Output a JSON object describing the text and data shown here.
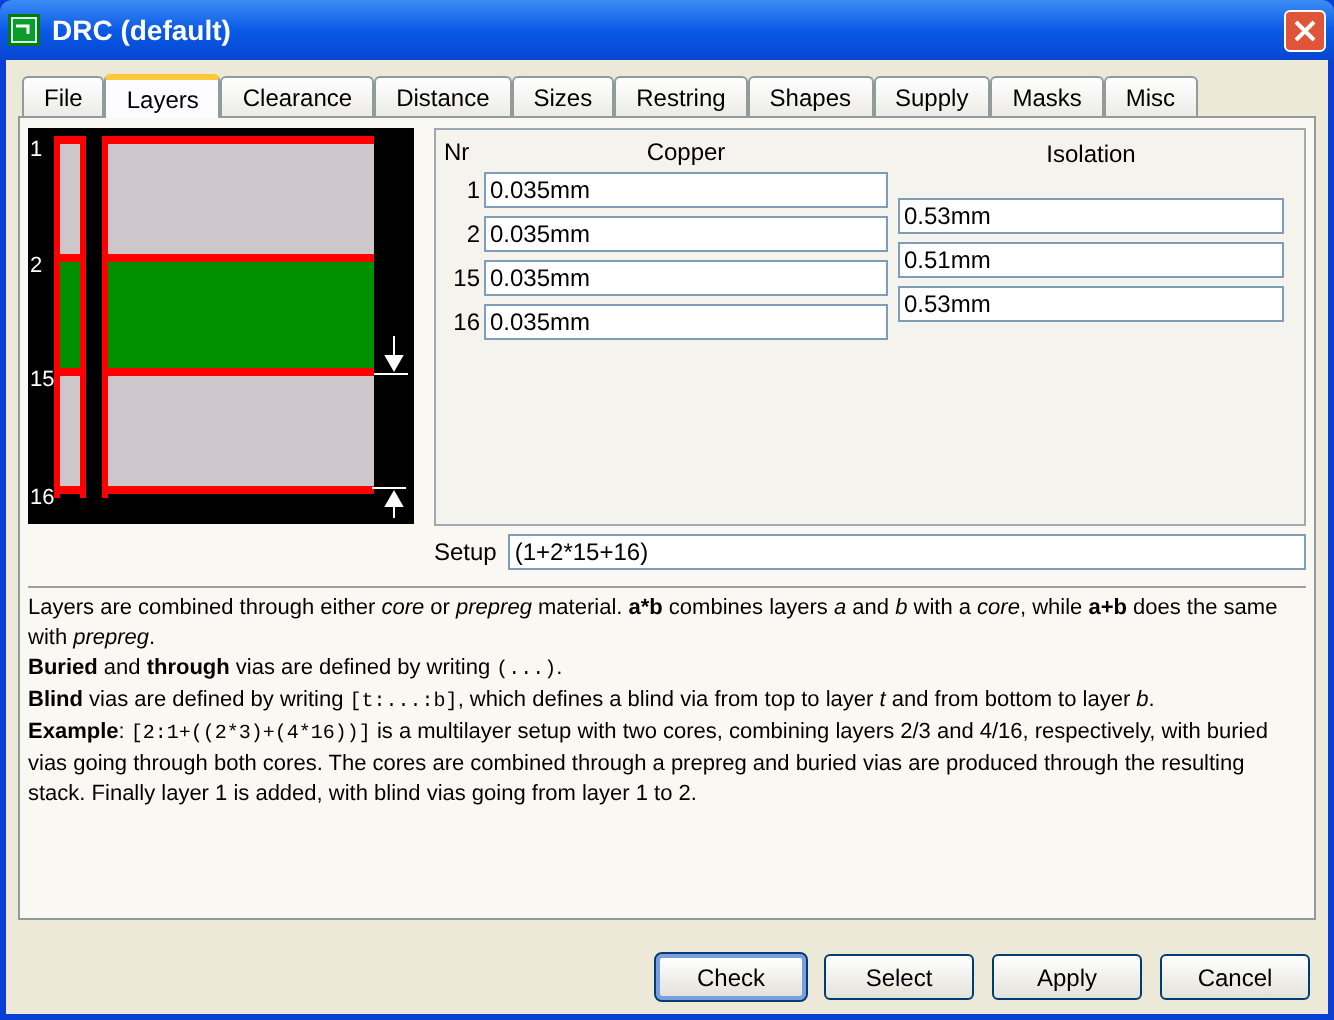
{
  "window": {
    "title": "DRC (default)"
  },
  "tabs": [
    {
      "label": "File",
      "selected": false
    },
    {
      "label": "Layers",
      "selected": true
    },
    {
      "label": "Clearance",
      "selected": false
    },
    {
      "label": "Distance",
      "selected": false
    },
    {
      "label": "Sizes",
      "selected": false
    },
    {
      "label": "Restring",
      "selected": false
    },
    {
      "label": "Shapes",
      "selected": false
    },
    {
      "label": "Supply",
      "selected": false
    },
    {
      "label": "Masks",
      "selected": false
    },
    {
      "label": "Misc",
      "selected": false
    }
  ],
  "diagram": {
    "layer_labels": [
      "1",
      "2",
      "15",
      "16"
    ]
  },
  "layers": {
    "columns": [
      "Nr",
      "Copper",
      "Isolation"
    ],
    "copper_rows": [
      {
        "nr": "1",
        "copper": "0.035mm"
      },
      {
        "nr": "2",
        "copper": "0.035mm"
      },
      {
        "nr": "15",
        "copper": "0.035mm"
      },
      {
        "nr": "16",
        "copper": "0.035mm"
      }
    ],
    "isolation": [
      "0.53mm",
      "0.51mm",
      "0.53mm"
    ]
  },
  "setup": {
    "label": "Setup",
    "value": "(1+2*15+16)"
  },
  "help": [
    [
      {
        "kind": "text",
        "text": "Layers are combined through either *core* or *prepreg* material. **a*b** combines layers *a* and *b* with a *core*, while **a+b** does the same with *prepreg*."
      }
    ],
    [
      {
        "kind": "text",
        "text": "**Buried** and **through** vias are defined by writing "
      },
      {
        "kind": "code",
        "text": "(...)"
      },
      {
        "kind": "text",
        "text": "."
      }
    ],
    [
      {
        "kind": "text",
        "text": "**Blind** vias are defined by writing "
      },
      {
        "kind": "code",
        "text": "[t:...:b]"
      },
      {
        "kind": "text",
        "text": ", which defines a blind via from top to layer *t* and from bottom to layer *b*."
      }
    ],
    [
      {
        "kind": "text",
        "text": "**Example**: "
      },
      {
        "kind": "code",
        "text": "[2:1+((2*3)+(4*16))]"
      },
      {
        "kind": "text",
        "text": " is a multilayer setup with two cores, combining layers 2/3 and 4/16, respectively, with buried vias going through both cores. The cores are combined through a prepreg and buried vias are produced through the resulting stack. Finally layer 1 is added, with blind vias going from layer 1 to 2."
      }
    ]
  ],
  "buttons": [
    {
      "label": "Check",
      "default": true
    },
    {
      "label": "Select",
      "default": false
    },
    {
      "label": "Apply",
      "default": false
    },
    {
      "label": "Cancel",
      "default": false
    }
  ]
}
